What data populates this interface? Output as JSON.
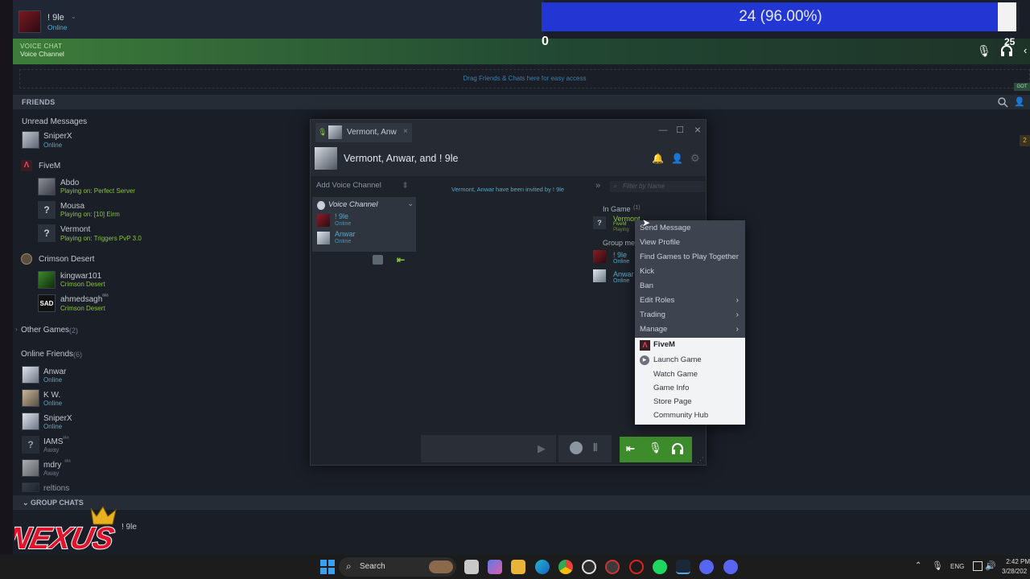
{
  "user": {
    "name": "! 9le",
    "status": "Online"
  },
  "voice_bar": {
    "title": "VOICE CHAT",
    "channel": "Voice Channel"
  },
  "drag_hint": "Drag Friends & Chats here for easy access",
  "friends_header": "FRIENDS",
  "progress": {
    "label": "24 (96.00%)",
    "fraction": 0.96,
    "min_label": "0",
    "max_label": "25"
  },
  "got_badge": "GOT",
  "side_badge": "2",
  "sections": {
    "unread": "Unread Messages",
    "fivem": "FiveM",
    "crimson": "Crimson Desert",
    "other_games": "Other Games",
    "other_games_count": "(2)",
    "online_friends": "Online Friends",
    "online_friends_count": "(6)"
  },
  "unread": [
    {
      "name": "SniperX",
      "status": "Online"
    }
  ],
  "fivem_friends": [
    {
      "name": "Abdo",
      "status": "Playing on: Perfect Server"
    },
    {
      "name": "Mousa",
      "status": "Playing on: [10] Eirm"
    },
    {
      "name": "Vermont",
      "status": "Playing on: Triggers PvP 3.0"
    }
  ],
  "crimson_friends": [
    {
      "name": "kingwar101",
      "status": "Crimson Desert"
    },
    {
      "name": "ahmedsagh",
      "status": "Crimson Desert",
      "nick": "ᵃᵏᵃ"
    }
  ],
  "online_friends": [
    {
      "name": "Anwar",
      "status": "Online"
    },
    {
      "name": "K W.",
      "status": "Online"
    },
    {
      "name": "SniperX",
      "status": "Online"
    },
    {
      "name": "IAMS",
      "status": "Away",
      "nick": "ᵃᵏᵃ"
    },
    {
      "name": "mdry",
      "status": "Away",
      "nick": "ᵃᵏᵃ"
    },
    {
      "name": "reltions",
      "status": ""
    }
  ],
  "group_chats": {
    "header": "GROUP CHATS",
    "item": "! 9le"
  },
  "chat": {
    "tab_title": "Vermont, Anw",
    "title": "Vermont, Anwar, and ! 9le",
    "add_voice": "Add Voice Channel",
    "voice_channel": "Voice Channel",
    "voice_members": [
      {
        "name": "! 9le",
        "status": "Online"
      },
      {
        "name": "Anwar",
        "status": "Online"
      }
    ],
    "invite_msg": "Vermont, Anwar have been invited by ! 9le",
    "filter_placeholder": "Filter by Name",
    "in_game": "In Game",
    "in_game_count": "(1)",
    "group_members": "Group me",
    "member_vermont": "Vermont",
    "member_vermont_game": "FiveM",
    "member_vermont_sub": "Playing",
    "member_9le": "! 9le",
    "member_9le_status": "Online",
    "member_anwar": "Anwar",
    "member_anwar_status": "Online"
  },
  "context_menu": {
    "items": [
      "Send Message",
      "View Profile",
      "Find Games to Play Together",
      "Kick",
      "Ban",
      "Edit Roles",
      "Trading",
      "Manage"
    ],
    "game": "FiveM",
    "game_items": [
      "Launch Game",
      "Watch Game",
      "Game Info",
      "Store Page",
      "Community Hub"
    ]
  },
  "taskbar": {
    "search": "Search",
    "lang": "ENG",
    "time": "2:42 PM",
    "date": "3/28/202"
  },
  "logo_text": "NEXUS",
  "colors": {
    "accent_green": "#8bc53f",
    "progress_fill": "#2136d2",
    "online_blue": "#58a8c9"
  }
}
